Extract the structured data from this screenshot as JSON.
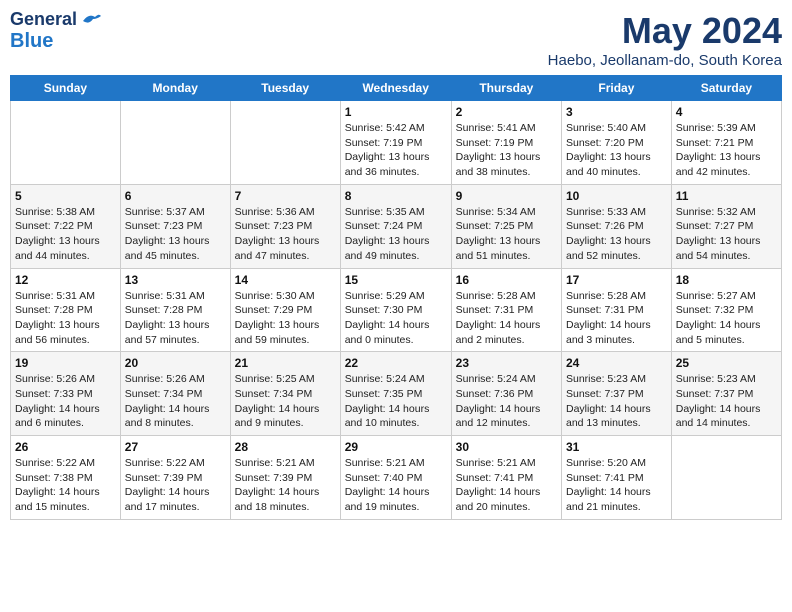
{
  "logo": {
    "line1": "General",
    "line2": "Blue"
  },
  "header": {
    "month": "May 2024",
    "location": "Haebo, Jeollanam-do, South Korea"
  },
  "weekdays": [
    "Sunday",
    "Monday",
    "Tuesday",
    "Wednesday",
    "Thursday",
    "Friday",
    "Saturday"
  ],
  "weeks": [
    [
      {
        "day": "",
        "info": ""
      },
      {
        "day": "",
        "info": ""
      },
      {
        "day": "",
        "info": ""
      },
      {
        "day": "1",
        "info": "Sunrise: 5:42 AM\nSunset: 7:19 PM\nDaylight: 13 hours\nand 36 minutes."
      },
      {
        "day": "2",
        "info": "Sunrise: 5:41 AM\nSunset: 7:19 PM\nDaylight: 13 hours\nand 38 minutes."
      },
      {
        "day": "3",
        "info": "Sunrise: 5:40 AM\nSunset: 7:20 PM\nDaylight: 13 hours\nand 40 minutes."
      },
      {
        "day": "4",
        "info": "Sunrise: 5:39 AM\nSunset: 7:21 PM\nDaylight: 13 hours\nand 42 minutes."
      }
    ],
    [
      {
        "day": "5",
        "info": "Sunrise: 5:38 AM\nSunset: 7:22 PM\nDaylight: 13 hours\nand 44 minutes."
      },
      {
        "day": "6",
        "info": "Sunrise: 5:37 AM\nSunset: 7:23 PM\nDaylight: 13 hours\nand 45 minutes."
      },
      {
        "day": "7",
        "info": "Sunrise: 5:36 AM\nSunset: 7:23 PM\nDaylight: 13 hours\nand 47 minutes."
      },
      {
        "day": "8",
        "info": "Sunrise: 5:35 AM\nSunset: 7:24 PM\nDaylight: 13 hours\nand 49 minutes."
      },
      {
        "day": "9",
        "info": "Sunrise: 5:34 AM\nSunset: 7:25 PM\nDaylight: 13 hours\nand 51 minutes."
      },
      {
        "day": "10",
        "info": "Sunrise: 5:33 AM\nSunset: 7:26 PM\nDaylight: 13 hours\nand 52 minutes."
      },
      {
        "day": "11",
        "info": "Sunrise: 5:32 AM\nSunset: 7:27 PM\nDaylight: 13 hours\nand 54 minutes."
      }
    ],
    [
      {
        "day": "12",
        "info": "Sunrise: 5:31 AM\nSunset: 7:28 PM\nDaylight: 13 hours\nand 56 minutes."
      },
      {
        "day": "13",
        "info": "Sunrise: 5:31 AM\nSunset: 7:28 PM\nDaylight: 13 hours\nand 57 minutes."
      },
      {
        "day": "14",
        "info": "Sunrise: 5:30 AM\nSunset: 7:29 PM\nDaylight: 13 hours\nand 59 minutes."
      },
      {
        "day": "15",
        "info": "Sunrise: 5:29 AM\nSunset: 7:30 PM\nDaylight: 14 hours\nand 0 minutes."
      },
      {
        "day": "16",
        "info": "Sunrise: 5:28 AM\nSunset: 7:31 PM\nDaylight: 14 hours\nand 2 minutes."
      },
      {
        "day": "17",
        "info": "Sunrise: 5:28 AM\nSunset: 7:31 PM\nDaylight: 14 hours\nand 3 minutes."
      },
      {
        "day": "18",
        "info": "Sunrise: 5:27 AM\nSunset: 7:32 PM\nDaylight: 14 hours\nand 5 minutes."
      }
    ],
    [
      {
        "day": "19",
        "info": "Sunrise: 5:26 AM\nSunset: 7:33 PM\nDaylight: 14 hours\nand 6 minutes."
      },
      {
        "day": "20",
        "info": "Sunrise: 5:26 AM\nSunset: 7:34 PM\nDaylight: 14 hours\nand 8 minutes."
      },
      {
        "day": "21",
        "info": "Sunrise: 5:25 AM\nSunset: 7:34 PM\nDaylight: 14 hours\nand 9 minutes."
      },
      {
        "day": "22",
        "info": "Sunrise: 5:24 AM\nSunset: 7:35 PM\nDaylight: 14 hours\nand 10 minutes."
      },
      {
        "day": "23",
        "info": "Sunrise: 5:24 AM\nSunset: 7:36 PM\nDaylight: 14 hours\nand 12 minutes."
      },
      {
        "day": "24",
        "info": "Sunrise: 5:23 AM\nSunset: 7:37 PM\nDaylight: 14 hours\nand 13 minutes."
      },
      {
        "day": "25",
        "info": "Sunrise: 5:23 AM\nSunset: 7:37 PM\nDaylight: 14 hours\nand 14 minutes."
      }
    ],
    [
      {
        "day": "26",
        "info": "Sunrise: 5:22 AM\nSunset: 7:38 PM\nDaylight: 14 hours\nand 15 minutes."
      },
      {
        "day": "27",
        "info": "Sunrise: 5:22 AM\nSunset: 7:39 PM\nDaylight: 14 hours\nand 17 minutes."
      },
      {
        "day": "28",
        "info": "Sunrise: 5:21 AM\nSunset: 7:39 PM\nDaylight: 14 hours\nand 18 minutes."
      },
      {
        "day": "29",
        "info": "Sunrise: 5:21 AM\nSunset: 7:40 PM\nDaylight: 14 hours\nand 19 minutes."
      },
      {
        "day": "30",
        "info": "Sunrise: 5:21 AM\nSunset: 7:41 PM\nDaylight: 14 hours\nand 20 minutes."
      },
      {
        "day": "31",
        "info": "Sunrise: 5:20 AM\nSunset: 7:41 PM\nDaylight: 14 hours\nand 21 minutes."
      },
      {
        "day": "",
        "info": ""
      }
    ]
  ]
}
